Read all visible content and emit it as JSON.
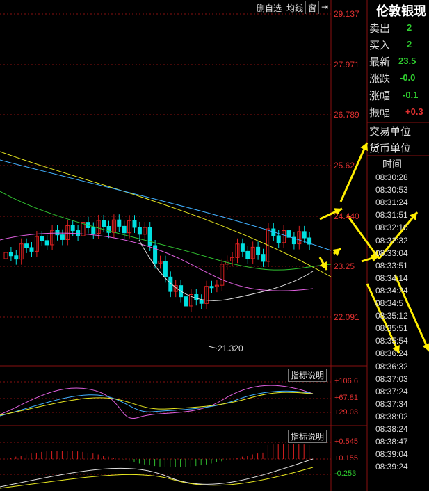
{
  "toolbar": {
    "delete_watch": "删自选",
    "ma_lines": "均线",
    "window": "窗",
    "arrow": "⇥"
  },
  "price_axis": [
    "29.137",
    "27.971",
    "26.789",
    "25.62",
    "24.440",
    "23.25",
    "22.091"
  ],
  "price_axis_notes": "right-axis price tick labels as printed (some partially covered by arrows)",
  "low_marker": "21.320",
  "indicator1": {
    "button": "指标说明",
    "labels": [
      "+106.6",
      "+67.81",
      "+29.03"
    ]
  },
  "indicator2": {
    "button": "指标说明",
    "labels": [
      "+0.545",
      "+0.155",
      "-0.253"
    ]
  },
  "panel": {
    "title": "伦敦银现",
    "sell_label": "卖出",
    "sell_value": "2",
    "buy_label": "买入",
    "buy_value": "2",
    "last_label": "最新",
    "last_value": "23.5",
    "change_label": "涨跌",
    "change_value": "-0.0",
    "pct_label": "涨幅",
    "pct_value": "-0.1",
    "amp_label": "振幅",
    "amp_value": "+0.3",
    "unit_label": "交易单位",
    "currency_label": "货币单位",
    "time_header": "时间",
    "times": [
      "08:30:28",
      "08:30:53",
      "08:31:24",
      "08:31:51",
      "08:32:10",
      "08:32:32",
      "08:33:04",
      "08:33:51",
      "08:34:14",
      "08:34:24",
      "08:34:5",
      "08:35:12",
      "08:35:51",
      "08:35:54",
      "08:36:24",
      "08:36:32",
      "08:37:03",
      "08:37:24",
      "08:37:34",
      "08:38:02",
      "08:38:24",
      "08:38:47",
      "08:39:04",
      "08:39:24"
    ]
  },
  "colors": {
    "up": "#e02020",
    "down": "#00e0e0",
    "ma_yellow": "#e8e820",
    "ma_cyan": "#40b0ff",
    "ma_green": "#30c030",
    "ma_pink": "#e060e0",
    "ma_white": "#e0e0e0",
    "arrow": "#ffee00",
    "grid": "#8a1010"
  }
}
